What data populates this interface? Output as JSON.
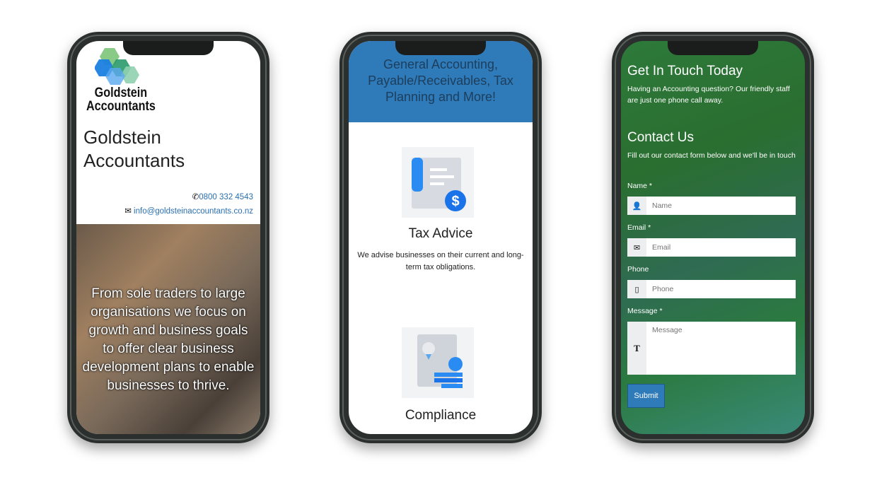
{
  "phone1": {
    "logo_text": [
      "Goldstein",
      "Accountants"
    ],
    "site_title": [
      "Goldstein",
      "Accountants"
    ],
    "phone": "0800 332 4543",
    "email": "info@goldsteinaccountants.co.nz",
    "hero_text": "From sole traders to large organisations we focus on growth and business goals to offer clear business development plans to enable businesses to thrive."
  },
  "phone2": {
    "banner": "General Accounting, Payable/Receivables, Tax Planning and More!",
    "services": [
      {
        "title": "Tax Advice",
        "description": "We advise businesses on their current and long-term tax obligations.",
        "icon": "tax-document-dollar-icon"
      },
      {
        "title": "Compliance",
        "icon": "certificate-coins-icon"
      }
    ]
  },
  "phone3": {
    "heading": "Get In Touch Today",
    "intro": "Having an Accounting question? Our friendly staff are just one phone call away.",
    "contact_heading": "Contact Us",
    "contact_intro": "Fill out our contact form below and we'll be in touch",
    "fields": [
      {
        "label": "Name *",
        "placeholder": "Name",
        "icon": "user-icon"
      },
      {
        "label": "Email *",
        "placeholder": "Email",
        "icon": "envelope-icon"
      },
      {
        "label": "Phone",
        "placeholder": "Phone",
        "icon": "mobile-icon"
      },
      {
        "label": "Message *",
        "placeholder": "Message",
        "icon": "text-icon"
      }
    ],
    "submit": "Submit"
  },
  "colors": {
    "brand_blue": "#2f7ab8",
    "link_blue": "#2a6fb0",
    "green_bg": "#2d7a3a"
  }
}
